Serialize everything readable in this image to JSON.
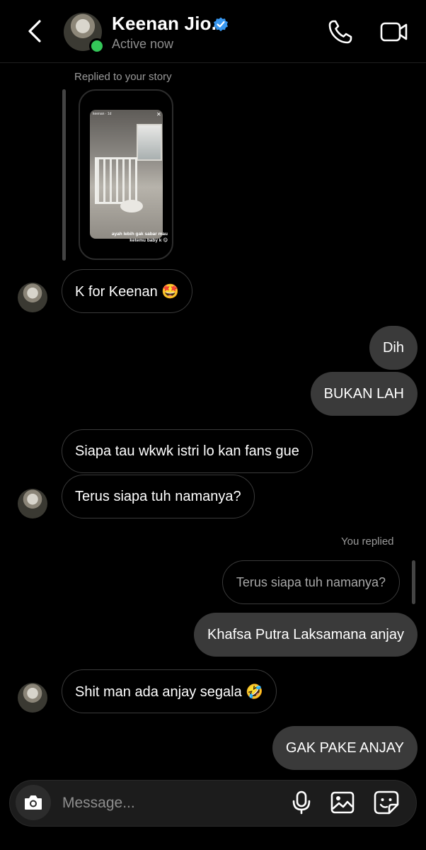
{
  "header": {
    "name": "Keenan Jio.",
    "status": "Active now",
    "icons": {
      "back": "chevron-left-icon",
      "verified": "verified-badge-icon",
      "call": "phone-icon",
      "video": "video-camera-icon"
    }
  },
  "story_reply": {
    "label": "Replied to your story",
    "story_top_text": "keenan · 1d",
    "story_caption": "ayah lebih gak sabar mau ketemu baby k 😋"
  },
  "messages": [
    {
      "side": "in",
      "text": "K for Keenan 🤩"
    },
    {
      "side": "out",
      "text": "Dih"
    },
    {
      "side": "out",
      "text": "BUKAN LAH"
    },
    {
      "side": "in",
      "text": "Siapa tau wkwk istri lo kan fans gue"
    },
    {
      "side": "in",
      "text": "Terus siapa tuh namanya?"
    },
    {
      "side": "out",
      "text": "Khafsa Putra Laksamana anjay",
      "reply_label": "You replied",
      "quoted": "Terus siapa tuh namanya?"
    },
    {
      "side": "in",
      "text": "Shit man ada anjay segala 🤣"
    },
    {
      "side": "out",
      "text": "GAK PAKE ANJAY"
    }
  ],
  "composer": {
    "placeholder": "Message...",
    "icons": [
      "camera-icon",
      "microphone-icon",
      "gallery-icon",
      "sticker-icon"
    ]
  },
  "colors": {
    "background": "#000000",
    "outgoing_bubble": "#3a3a3a",
    "incoming_border": "#3a3a3a",
    "verified": "#3897f0",
    "online": "#34c759"
  }
}
